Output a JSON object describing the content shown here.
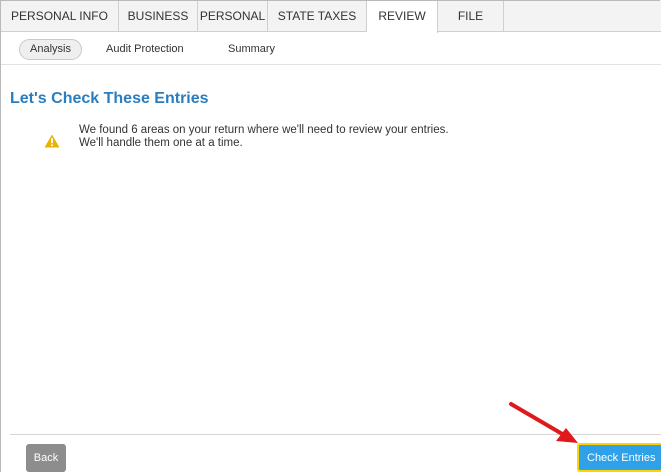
{
  "main_tabs": [
    {
      "label": "PERSONAL INFO",
      "active": false
    },
    {
      "label": "BUSINESS",
      "active": false
    },
    {
      "label": "PERSONAL",
      "active": false
    },
    {
      "label": "STATE TAXES",
      "active": false
    },
    {
      "label": "REVIEW",
      "active": true
    },
    {
      "label": "FILE",
      "active": false
    }
  ],
  "sub_tabs": [
    {
      "label": "Analysis",
      "active": true
    },
    {
      "label": "Audit Protection",
      "active": false
    },
    {
      "label": "Summary",
      "active": false
    }
  ],
  "page": {
    "title": "Let's Check These Entries",
    "message_line1": "We found 6 areas on your return where we'll need to review your entries.",
    "message_line2": "We'll handle them one at a time.",
    "warning_icon": "warning-triangle-icon"
  },
  "footer": {
    "back_label": "Back",
    "check_label": "Check Entries"
  },
  "colors": {
    "title": "#2a7dbf",
    "primary_button": "#2fa1e8",
    "primary_button_outline": "#ffd400",
    "back_button": "#8d8d8d",
    "warning": "#e8b400",
    "annotation_arrow": "#e0191c"
  }
}
